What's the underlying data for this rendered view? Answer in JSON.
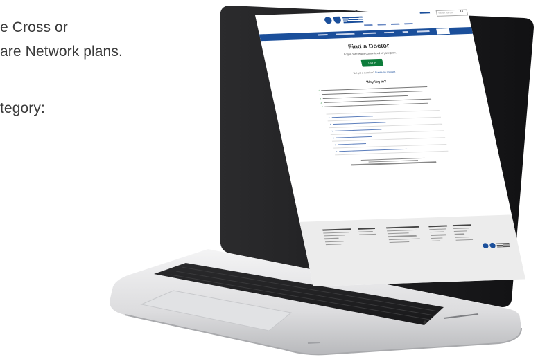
{
  "left_text": {
    "line1": "e Cross or",
    "line2": "are Network plans.",
    "line3": "tegory:"
  },
  "screen": {
    "page_title": "Find a Doctor",
    "subtitle": "Log in for results customized to your plan.",
    "login_button": "Log in",
    "register_prompt": "Not yet a member?",
    "register_link": "Create an account",
    "why_heading": "Why log in?",
    "search_placeholder": "Search our site"
  },
  "colors": {
    "brand_blue": "#1b4f9b",
    "login_green": "#0c7c3a",
    "footer_gray": "#ececec"
  }
}
